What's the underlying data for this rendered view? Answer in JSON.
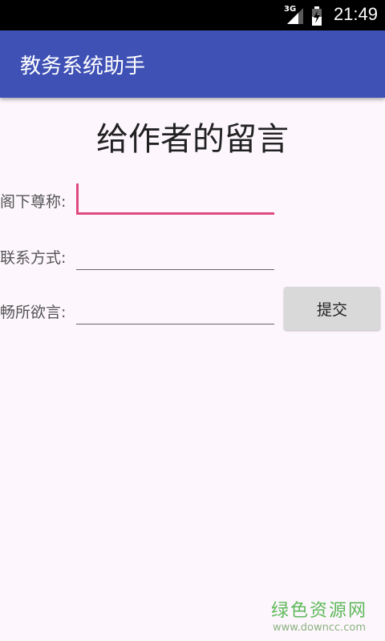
{
  "status_bar": {
    "network": "3G",
    "time": "21:49",
    "icons": [
      "signal-icon",
      "battery-charging-icon"
    ]
  },
  "app_bar": {
    "title": "教务系统助手",
    "color": "#3f51b5"
  },
  "page": {
    "title": "给作者的留言"
  },
  "form": {
    "name_label": "阁下尊称:",
    "name_value": "",
    "contact_label": "联系方式:",
    "contact_value": "",
    "message_label": "畅所欲言:",
    "message_value": "",
    "submit_label": "提交",
    "focus_color": "#e0497c"
  },
  "watermark": {
    "title": "绿色资源网",
    "url": "www.downcc.com"
  }
}
